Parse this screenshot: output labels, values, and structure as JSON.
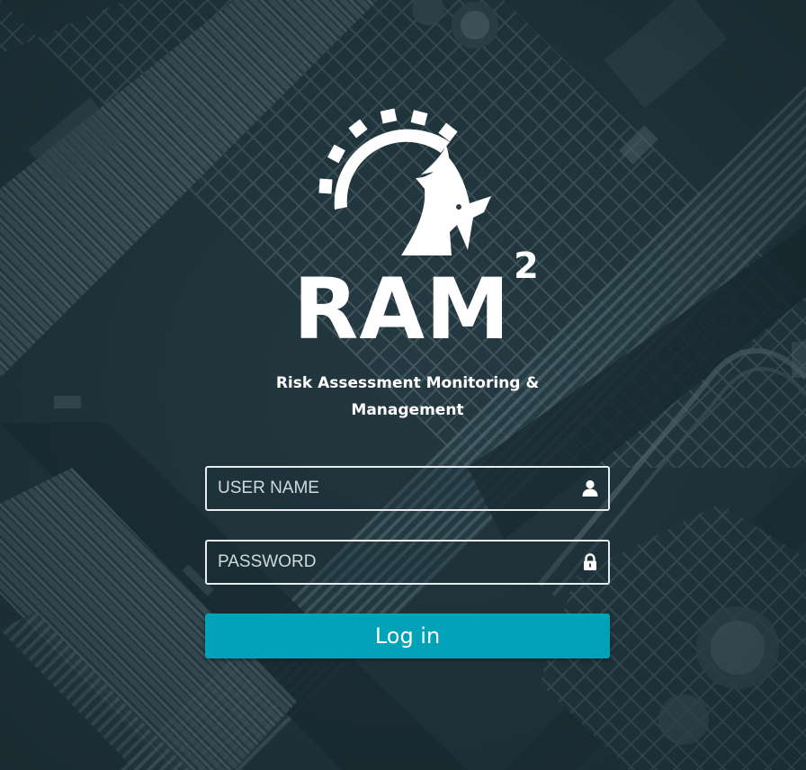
{
  "brand": {
    "name": "RAM",
    "superscript": "2",
    "tagline_line1": "Risk Assessment Monitoring &",
    "tagline_line2": "Management",
    "logo_icon": "gear-goat-logo"
  },
  "login_form": {
    "username": {
      "value": "",
      "placeholder": "USER NAME",
      "icon": "user-icon"
    },
    "password": {
      "value": "",
      "placeholder": "PASSWORD",
      "icon": "lock-icon"
    },
    "submit_label": "Log in"
  },
  "colors": {
    "accent": "#00a2b8",
    "background": "#2a3c44",
    "text": "#ffffff",
    "field_border": "#e6ecef"
  }
}
